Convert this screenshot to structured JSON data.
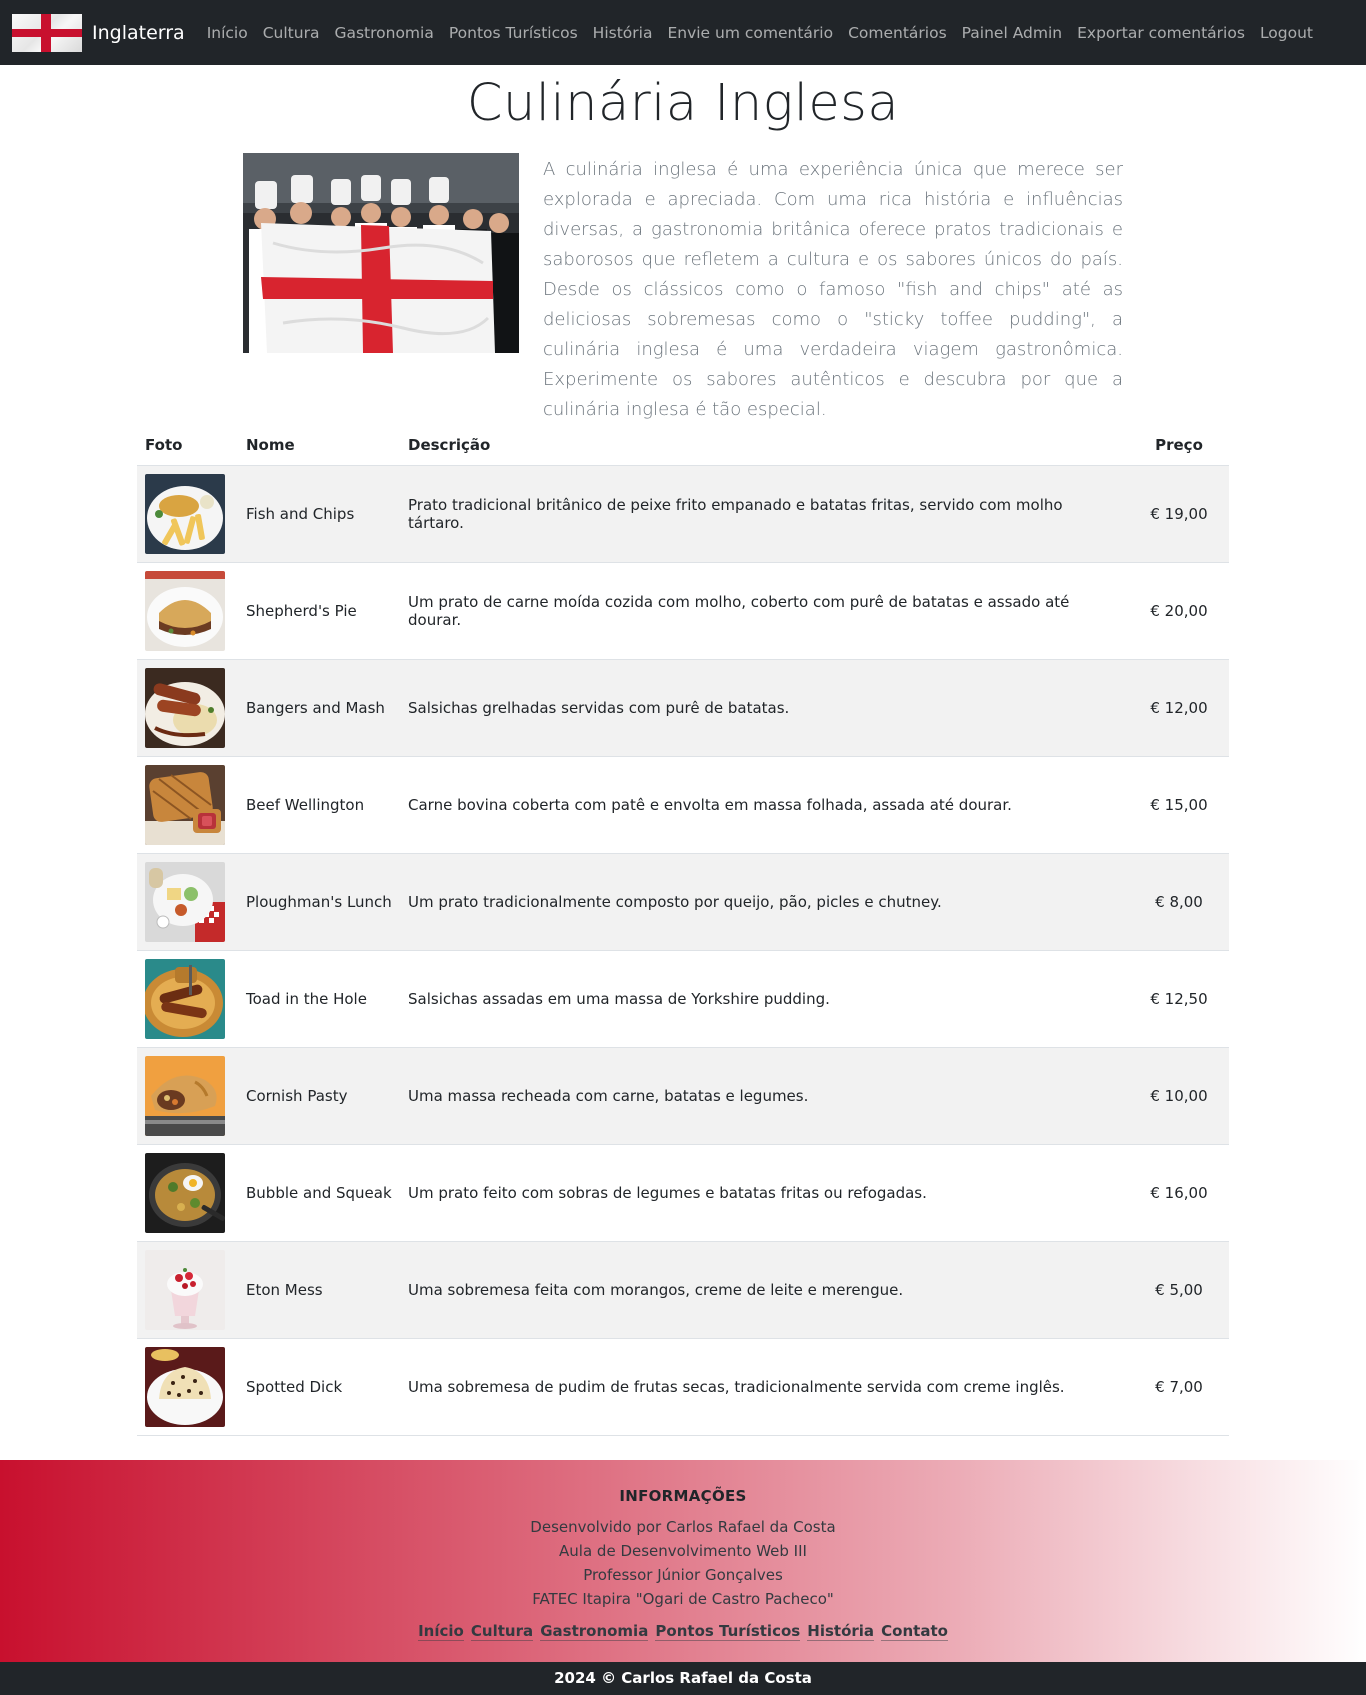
{
  "navbar": {
    "brand": "Inglaterra",
    "links": [
      "Início",
      "Cultura",
      "Gastronomia",
      "Pontos Turísticos",
      "História",
      "Envie um comentário",
      "Comentários",
      "Painel Admin",
      "Exportar comentários",
      "Logout"
    ]
  },
  "hero": {
    "title": "Culinária Inglesa",
    "image_alt": "chefs-holding-england-flag",
    "intro": "A culinária inglesa é uma experiência única que merece ser explorada e apreciada. Com uma rica história e influências diversas, a gastronomia britânica oferece pratos tradicionais e saborosos que refletem a cultura e os sabores únicos do país. Desde os clássicos como o famoso \"fish and chips\" até as deliciosas sobremesas como o \"sticky toffee pudding\", a culinária inglesa é uma verdadeira viagem gastronômica. Experimente os sabores autênticos e descubra por que a culinária inglesa é tão especial."
  },
  "table": {
    "headers": {
      "foto": "Foto",
      "nome": "Nome",
      "descricao": "Descrição",
      "preco": "Preço"
    },
    "rows": [
      {
        "nome": "Fish and Chips",
        "descricao": "Prato tradicional britânico de peixe frito empanado e batatas fritas, servido com molho tártaro.",
        "preco": "€ 19,00"
      },
      {
        "nome": "Shepherd's Pie",
        "descricao": "Um prato de carne moída cozida com molho, coberto com purê de batatas e assado até dourar.",
        "preco": "€ 20,00"
      },
      {
        "nome": "Bangers and Mash",
        "descricao": "Salsichas grelhadas servidas com purê de batatas.",
        "preco": "€ 12,00"
      },
      {
        "nome": "Beef Wellington",
        "descricao": "Carne bovina coberta com patê e envolta em massa folhada, assada até dourar.",
        "preco": "€ 15,00"
      },
      {
        "nome": "Ploughman's Lunch",
        "descricao": "Um prato tradicionalmente composto por queijo, pão, picles e chutney.",
        "preco": "€ 8,00"
      },
      {
        "nome": "Toad in the Hole",
        "descricao": "Salsichas assadas em uma massa de Yorkshire pudding.",
        "preco": "€ 12,50"
      },
      {
        "nome": "Cornish Pasty",
        "descricao": "Uma massa recheada com carne, batatas e legumes.",
        "preco": "€ 10,00"
      },
      {
        "nome": "Bubble and Squeak",
        "descricao": "Um prato feito com sobras de legumes e batatas fritas ou refogadas.",
        "preco": "€ 16,00"
      },
      {
        "nome": "Eton Mess",
        "descricao": "Uma sobremesa feita com morangos, creme de leite e merengue.",
        "preco": "€ 5,00"
      },
      {
        "nome": "Spotted Dick",
        "descricao": "Uma sobremesa de pudim de frutas secas, tradicionalmente servida com creme inglês.",
        "preco": "€ 7,00"
      }
    ]
  },
  "footer": {
    "title": "INFORMAÇÕES",
    "lines": [
      "Desenvolvido por Carlos Rafael da Costa",
      "Aula de Desenvolvimento Web III",
      "Professor Júnior Gonçalves",
      "FATEC Itapira \"Ogari de Castro Pacheco\""
    ],
    "links": [
      "Início",
      "Cultura",
      "Gastronomia",
      "Pontos Turísticos",
      "História",
      "Contato"
    ],
    "copyright": "2024 © Carlos Rafael da Costa"
  },
  "colors": {
    "navbar_bg": "#212529",
    "accent_red": "#c8102e",
    "stripe": "#f2f2f2",
    "muted_text": "#6c757d"
  }
}
